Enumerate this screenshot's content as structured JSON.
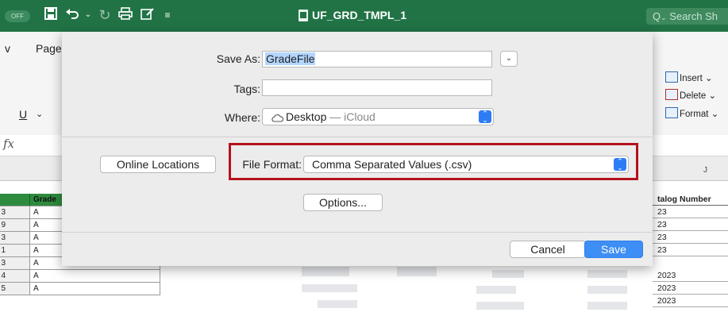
{
  "titlebar": {
    "autosave_label": "OFF",
    "document_title": "UF_GRD_TMPL_1",
    "search_placeholder": "Search Sh"
  },
  "ribbon": {
    "tab_partial_1": "v",
    "tab_partial_2": "Page",
    "underline_label": "U",
    "fx_label": "fx",
    "insert_label": "Insert",
    "delete_label": "Delete",
    "format_label": "Format",
    "column_j": "J"
  },
  "sheet": {
    "grade_header": "Grade",
    "catalog_header": "talog Number",
    "rows": [
      {
        "num": "3",
        "grade": "A",
        "catalog": "23"
      },
      {
        "num": "9",
        "grade": "A",
        "catalog": "23"
      },
      {
        "num": "3",
        "grade": "A",
        "catalog": "23"
      },
      {
        "num": "1",
        "grade": "A",
        "catalog": "23"
      },
      {
        "num": "3",
        "grade": "A",
        "catalog": "2023"
      },
      {
        "num": "4",
        "grade": "A",
        "catalog": "2023"
      },
      {
        "num": "5",
        "grade": "A",
        "catalog": "2023"
      }
    ]
  },
  "dialog": {
    "save_as_label": "Save As:",
    "save_as_value": "GradeFile",
    "tags_label": "Tags:",
    "tags_value": "",
    "where_label": "Where:",
    "where_value": "Desktop",
    "where_sub": "— iCloud",
    "online_locations": "Online Locations",
    "file_format_label": "File Format:",
    "file_format_value": "Comma Separated Values (.csv)",
    "options_label": "Options...",
    "cancel_label": "Cancel",
    "save_label": "Save",
    "accent_color": "#3d8ef5",
    "highlight_color": "#b4121c"
  }
}
